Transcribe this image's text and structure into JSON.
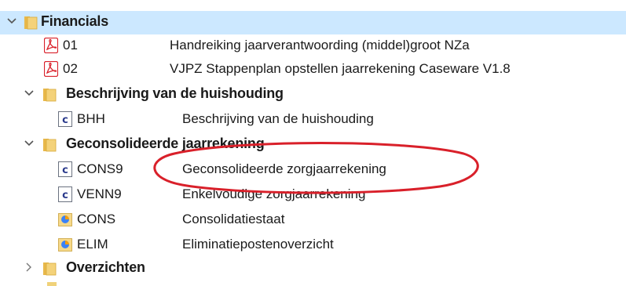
{
  "tree": {
    "groups": [
      {
        "label": "Financials",
        "selected": true,
        "items": [
          {
            "code": "01",
            "description": "Handreiking jaarverantwoording (middel)groot NZa",
            "icon": "pdf-icon"
          },
          {
            "code": "02",
            "description": "VJPZ Stappenplan opstellen jaarrekening Caseware V1.8",
            "icon": "pdf-icon"
          }
        ]
      },
      {
        "label": "Beschrijving van de huishouding",
        "items": [
          {
            "code": "BHH",
            "description": "Beschrijving van de huishouding",
            "icon": "document-c-icon"
          }
        ]
      },
      {
        "label": "Geconsolideerde jaarrekening",
        "items": [
          {
            "code": "CONS9",
            "description": "Geconsolideerde zorgjaarrekening",
            "icon": "document-c-icon"
          },
          {
            "code": "VENN9",
            "description": "Enkelvoudige zorgjaarrekening",
            "icon": "document-c-icon"
          },
          {
            "code": "CONS",
            "description": "Consolidatiestaat",
            "icon": "worksheet-icon"
          },
          {
            "code": "ELIM",
            "description": "Eliminatiepostenoverzicht",
            "icon": "worksheet-icon"
          }
        ]
      },
      {
        "label": "Overzichten",
        "collapsed": true,
        "items": []
      }
    ]
  },
  "colors": {
    "selection": "#cce8ff",
    "folder": "#f0c040",
    "annotation": "#d9202a",
    "pdf": "#d9202a"
  }
}
